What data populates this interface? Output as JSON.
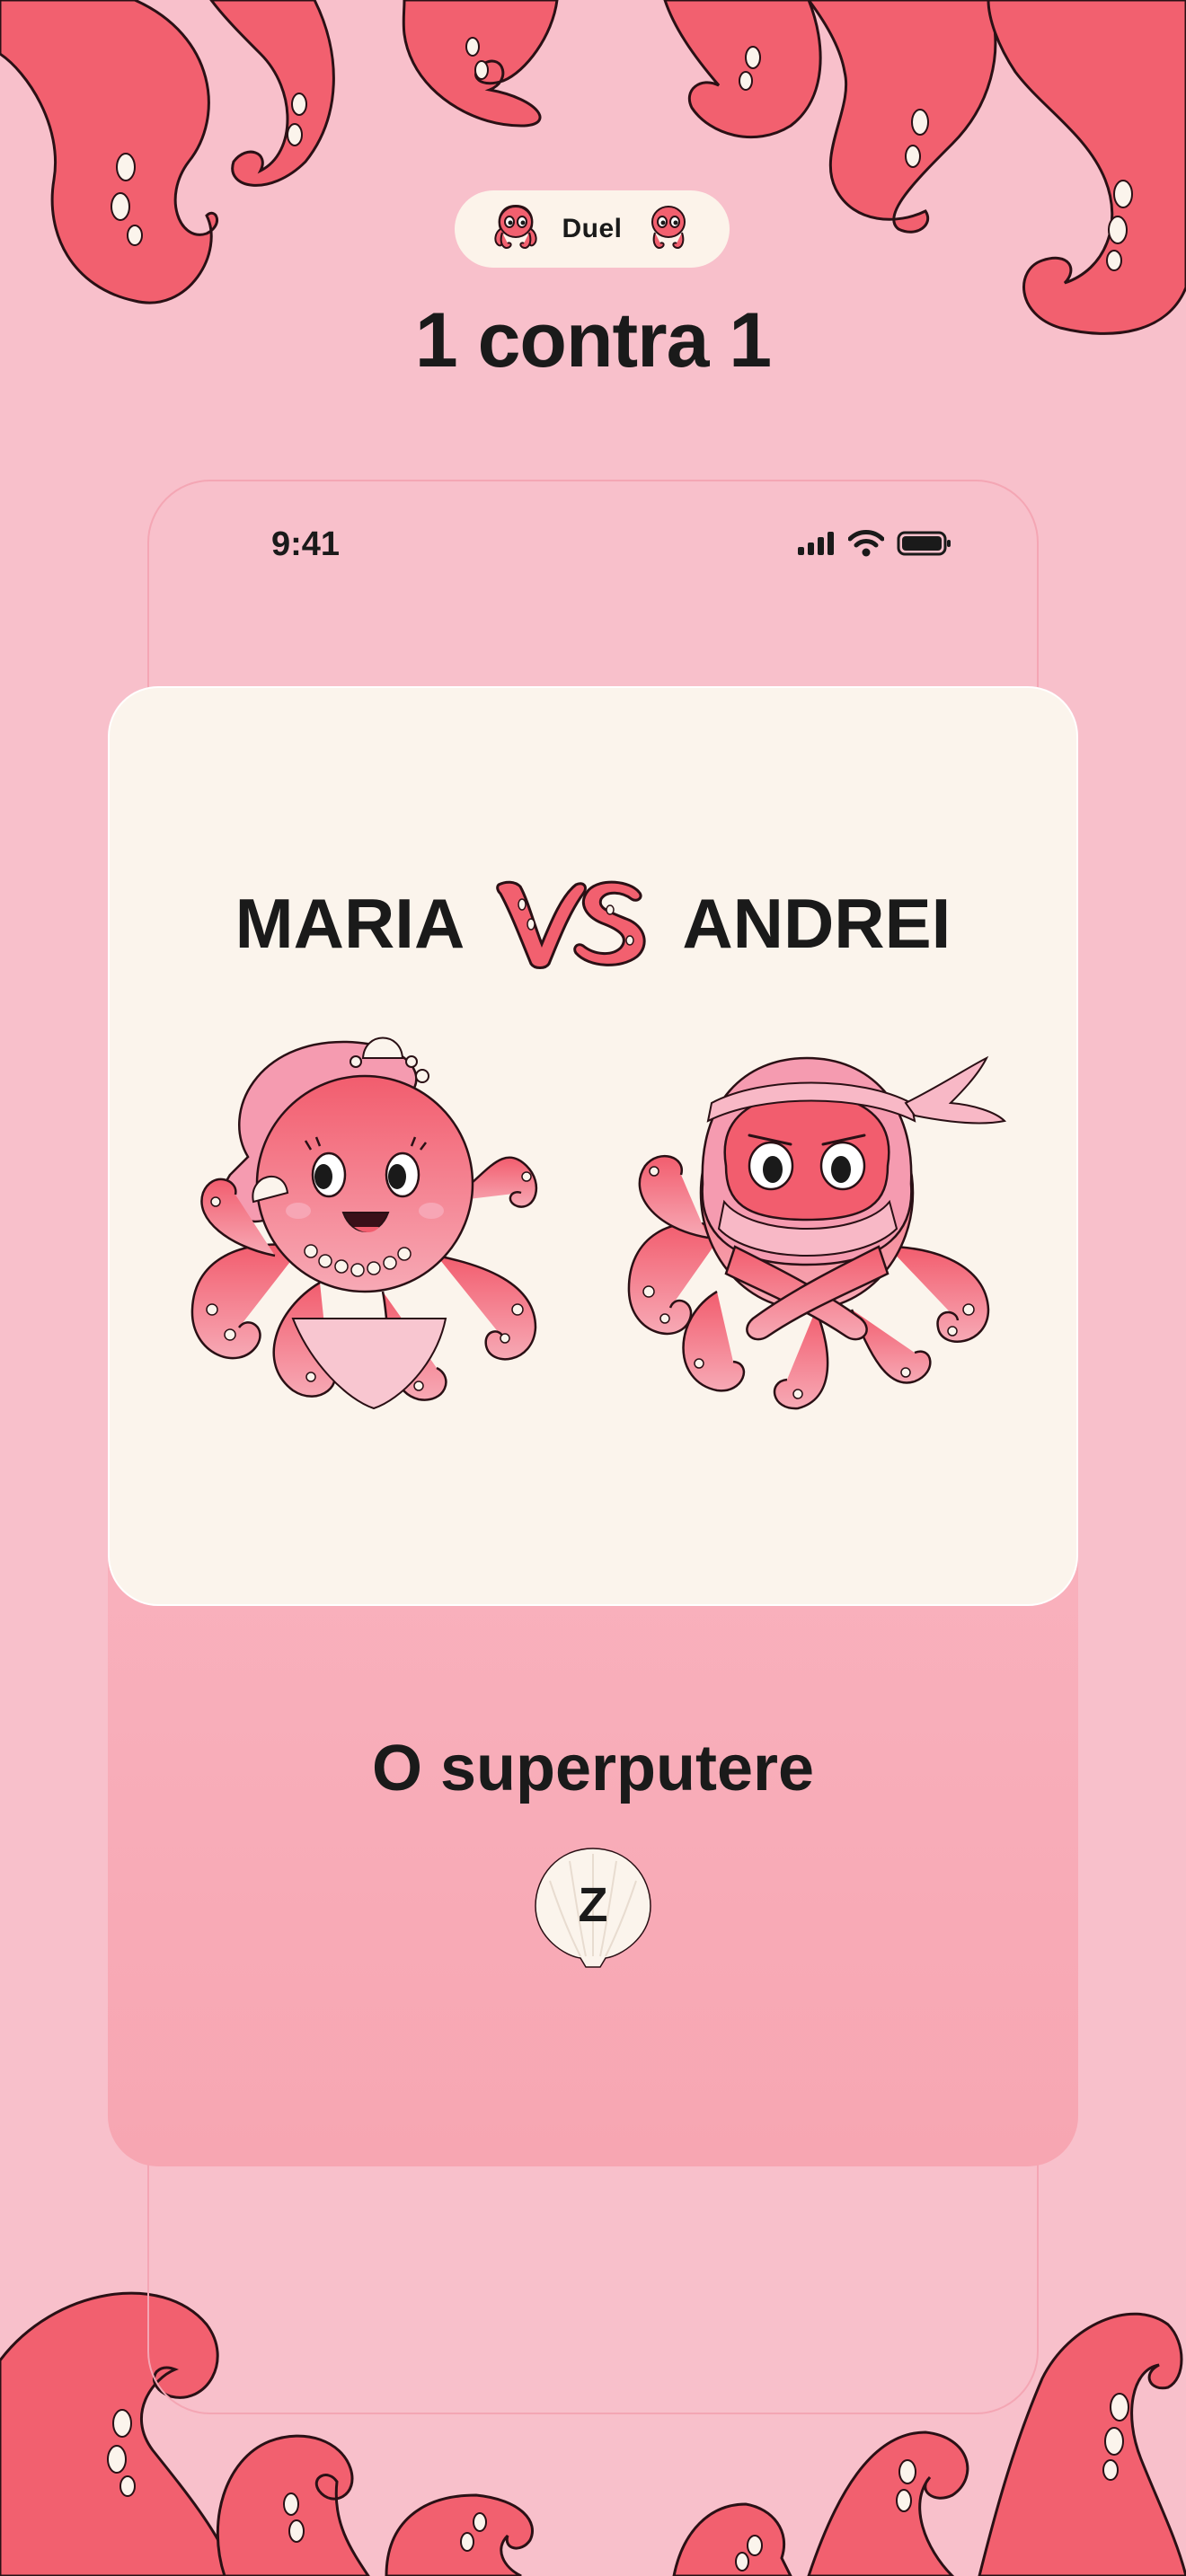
{
  "badge": {
    "label": "Duel",
    "icon": "octopus-icon"
  },
  "title": "1 contra 1",
  "status_bar": {
    "time": "9:41",
    "icons": [
      "signal-icon",
      "wifi-icon",
      "battery-icon"
    ]
  },
  "duel": {
    "player_left": "MARIA",
    "player_right": "ANDREI",
    "vs_mark": "VS",
    "category": "O superputere",
    "letter": "Z"
  },
  "colors": {
    "background": "#f8c0cb",
    "tentacle": "#f2606f",
    "card": "#fbf4ec",
    "panel": "#f9b1bd",
    "text": "#1a1a1a"
  }
}
